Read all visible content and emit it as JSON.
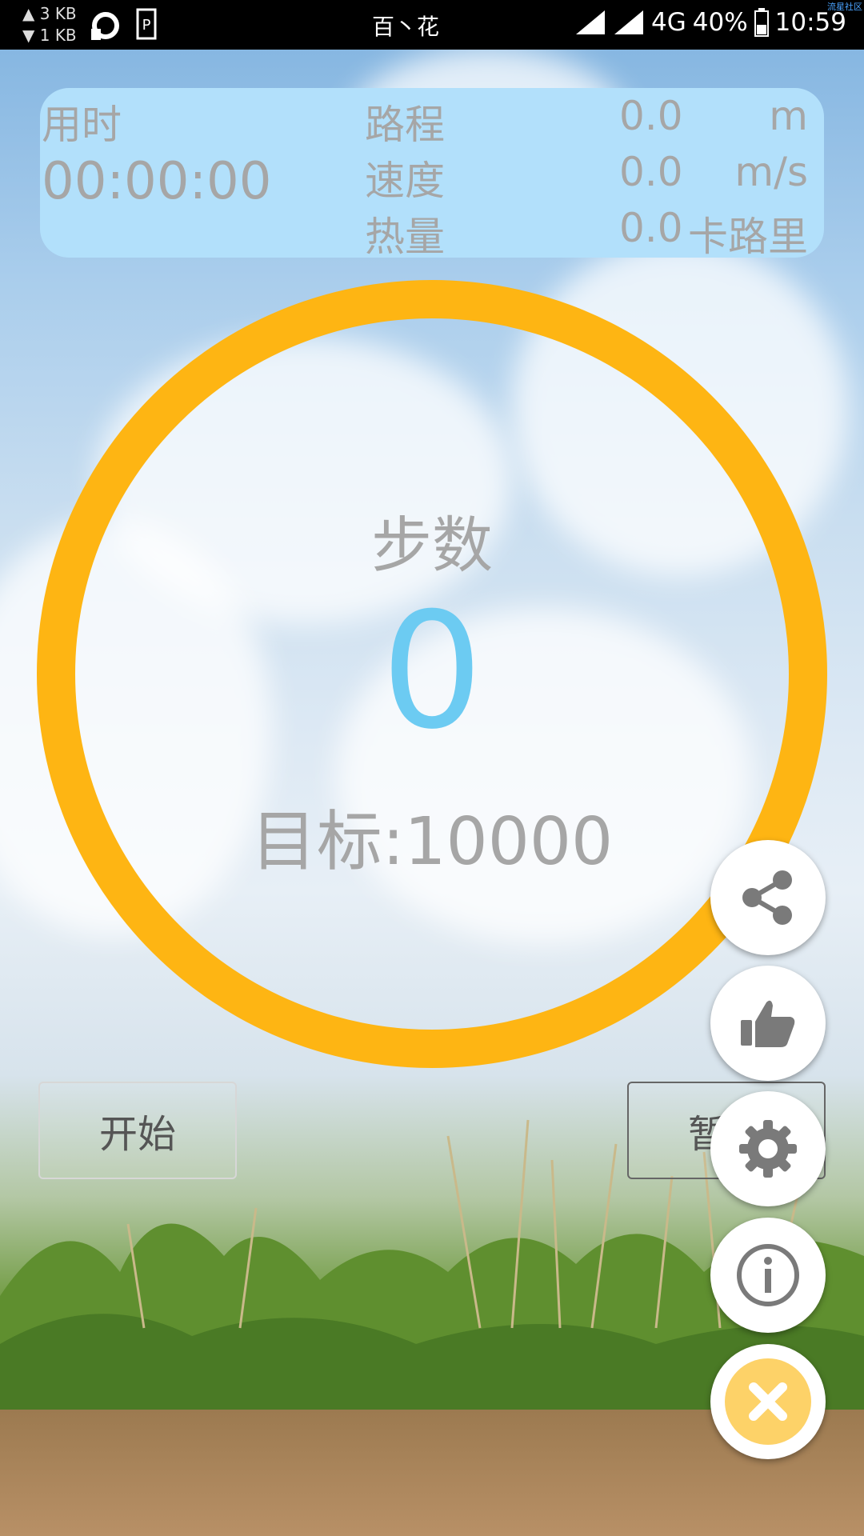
{
  "status_bar": {
    "upload_speed": "▲ 3 KB",
    "download_speed": "▼ 1 KB",
    "carrier": "百丶花",
    "network": "4G",
    "battery": "40%",
    "time": "10:59",
    "corner_mark": "流星社区"
  },
  "stats": {
    "time_label": "用时",
    "timer": "00:00:00",
    "distance_label": "路程",
    "distance_value": "0.0",
    "distance_unit": "m",
    "speed_label": "速度",
    "speed_value": "0.0",
    "speed_unit": "m/s",
    "calorie_label": "热量",
    "calorie_value": "0.0",
    "calorie_unit": "卡路里"
  },
  "ring": {
    "steps_label": "步数",
    "steps_value": "0",
    "goal": "目标:10000"
  },
  "buttons": {
    "start_label": "开始",
    "pause_label": "暂停"
  },
  "fab_menu": {
    "items": [
      "share-icon",
      "thumbs-up-icon",
      "gear-icon",
      "info-icon",
      "close-icon"
    ]
  },
  "colors": {
    "ring": "#feb513",
    "panel": "#b2e0fb",
    "steps_value": "#6ccbf2",
    "muted_text": "#a6a6a6",
    "close_fab": "#fdd268"
  }
}
